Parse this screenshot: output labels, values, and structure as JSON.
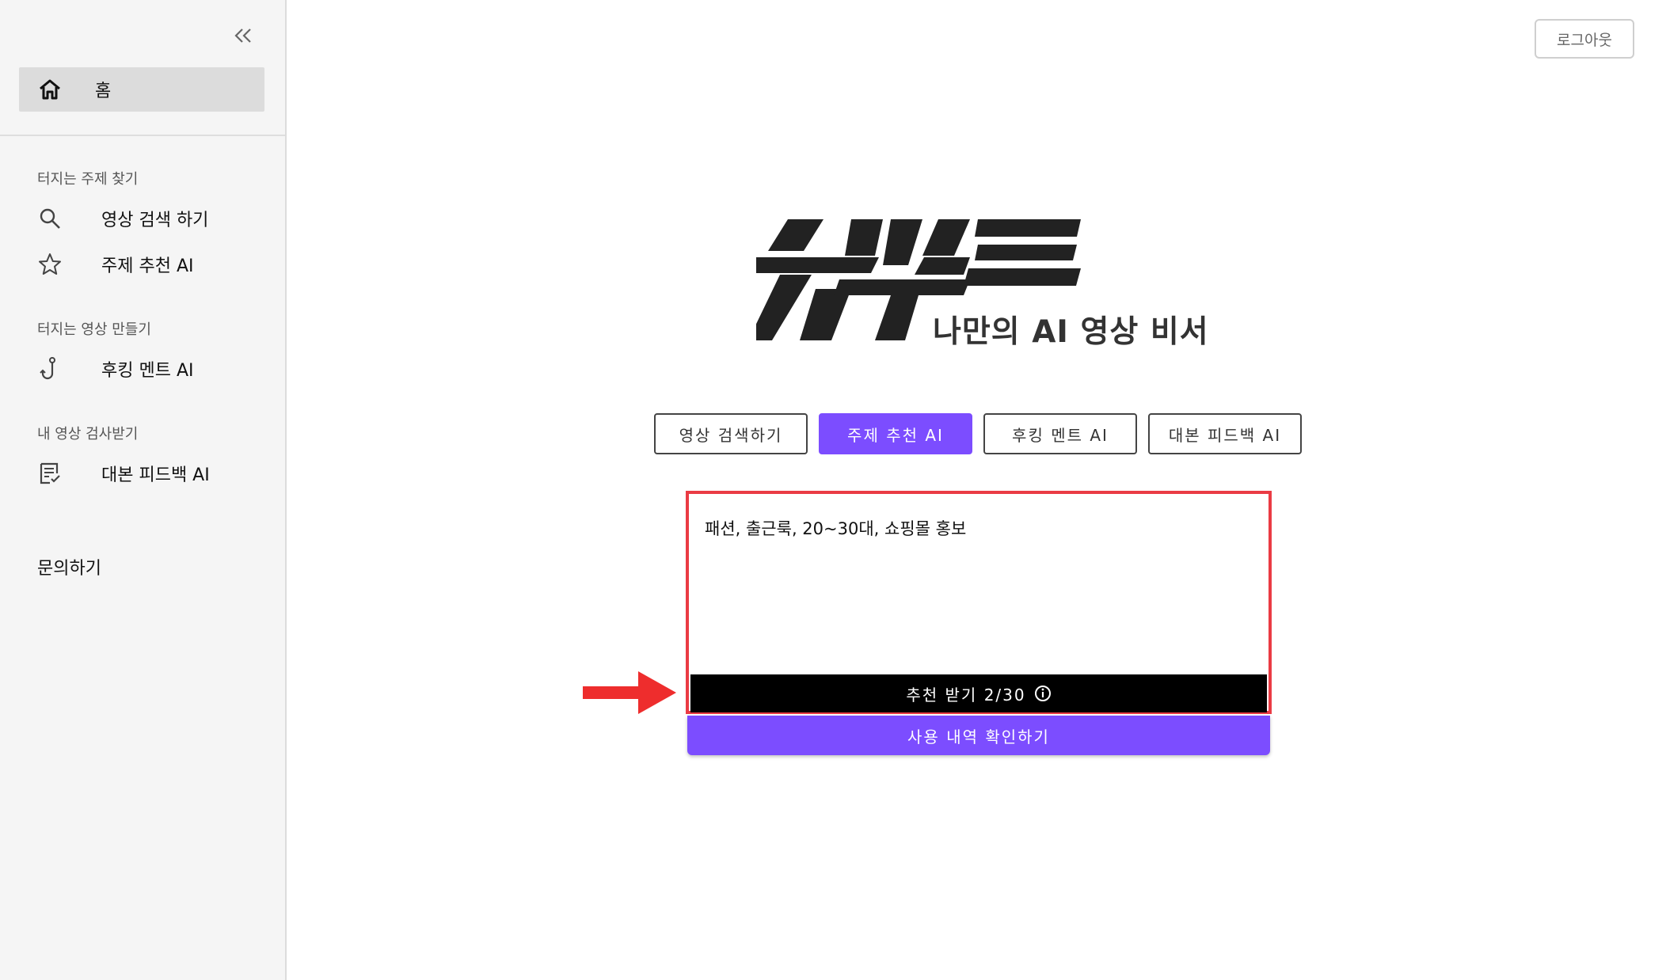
{
  "sidebar": {
    "home_label": "홈",
    "sections": [
      {
        "title": "터지는 주제 찾기",
        "items": [
          {
            "label": "영상 검색 하기",
            "icon": "search-icon"
          },
          {
            "label": "주제 추천 AI",
            "icon": "star-icon"
          }
        ]
      },
      {
        "title": "터지는 영상 만들기",
        "items": [
          {
            "label": "후킹 멘트 AI",
            "icon": "hook-icon"
          }
        ]
      },
      {
        "title": "내 영상 검사받기",
        "items": [
          {
            "label": "대본 피드백 AI",
            "icon": "document-check-icon"
          }
        ]
      }
    ],
    "contact_label": "문의하기"
  },
  "header": {
    "logout_label": "로그아웃"
  },
  "hero": {
    "tagline": "나만의 AI 영상 비서"
  },
  "tabs": [
    {
      "label": "영상 검색하기",
      "active": false
    },
    {
      "label": "주제 추천 AI",
      "active": true
    },
    {
      "label": "후킹 멘트 AI",
      "active": false
    },
    {
      "label": "대본 피드백 AI",
      "active": false
    }
  ],
  "form": {
    "input_value": "패션, 출근룩, 20~30대, 쇼핑몰 홍보",
    "submit_label": "추천 받기 2/30",
    "history_label": "사용 내역 확인하기"
  },
  "colors": {
    "accent": "#7c4dff",
    "highlight_border": "#ea3b44",
    "arrow": "#ee2d2d",
    "sidebar_bg": "#f5f5f5"
  }
}
